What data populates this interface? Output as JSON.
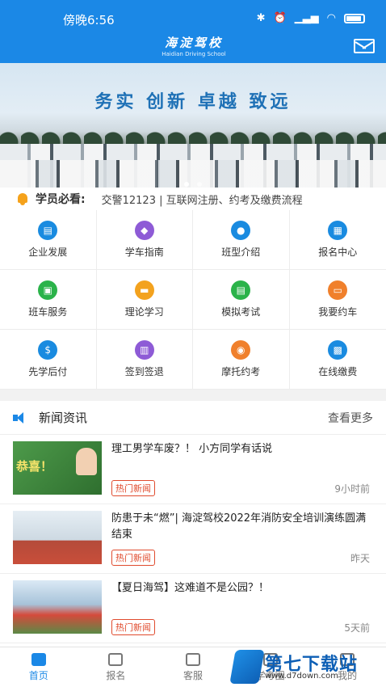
{
  "status": {
    "time": "傍晚6:56"
  },
  "header": {
    "logo_cn": "海淀驾校",
    "logo_en": "Haidian Driving School"
  },
  "banner": {
    "slogan": "务实  创新  卓越  致远"
  },
  "notice": {
    "label": "学员必看:",
    "text": "交警12123 | 互联网注册、约考及缴费流程"
  },
  "grid": [
    {
      "label": "企业发展",
      "icon": "building-icon",
      "color": "#1a8be0"
    },
    {
      "label": "学车指南",
      "icon": "graduation-cap-icon",
      "color": "#8e5bd6"
    },
    {
      "label": "班型介绍",
      "icon": "location-icon",
      "color": "#1a8be0"
    },
    {
      "label": "报名中心",
      "icon": "form-icon",
      "color": "#1a8be0"
    },
    {
      "label": "班车服务",
      "icon": "bus-icon",
      "color": "#2bb34a"
    },
    {
      "label": "理论学习",
      "icon": "book-icon",
      "color": "#f3a21e"
    },
    {
      "label": "模拟考试",
      "icon": "exam-icon",
      "color": "#2bb34a"
    },
    {
      "label": "我要约车",
      "icon": "car-icon",
      "color": "#f0802c"
    },
    {
      "label": "先学后付",
      "icon": "coin-icon",
      "color": "#1a8be0"
    },
    {
      "label": "签到签退",
      "icon": "calendar-icon",
      "color": "#8e5bd6"
    },
    {
      "label": "摩托约考",
      "icon": "motorcycle-icon",
      "color": "#f0802c"
    },
    {
      "label": "在线缴费",
      "icon": "wallet-icon",
      "color": "#1a8be0"
    }
  ],
  "news": {
    "title": "新闻资讯",
    "more": "查看更多",
    "items": [
      {
        "title": "理工男学车废？！ 小方同学有话说",
        "tag": "热门新闻",
        "time": "9小时前"
      },
      {
        "title": "防患于未“燃”| 海淀驾校2022年消防安全培训演练圆满结束",
        "tag": "热门新闻",
        "time": "昨天"
      },
      {
        "title": "【夏日海驾】这难道不是公园？！",
        "tag": "热门新闻",
        "time": "5天前"
      }
    ]
  },
  "tabs": [
    {
      "label": "首页",
      "icon": "home-icon"
    },
    {
      "label": "报名",
      "icon": "signup-icon"
    },
    {
      "label": "客服",
      "icon": "service-icon"
    },
    {
      "label": "学考圈",
      "icon": "community-icon"
    },
    {
      "label": "我的",
      "icon": "user-icon"
    }
  ],
  "watermark": {
    "text": "第七下载站",
    "sub": "www.d7down.com"
  },
  "colors": {
    "primary": "#1b88e6",
    "tag": "#e04b2e"
  }
}
